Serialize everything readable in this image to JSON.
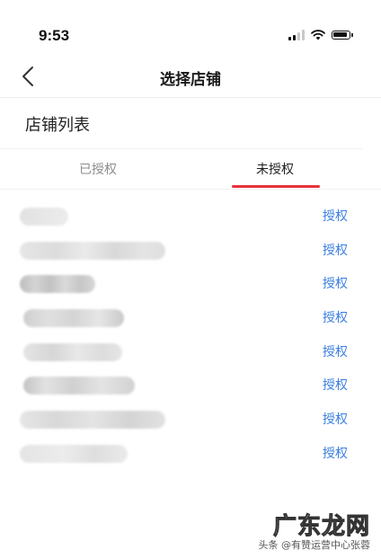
{
  "status_bar": {
    "time": "9:53",
    "icons": [
      "signal-icon",
      "wifi-icon",
      "battery-icon"
    ]
  },
  "nav": {
    "back_icon": "chevron-left-icon",
    "title": "选择店铺"
  },
  "section": {
    "title": "店铺列表"
  },
  "tabs": [
    {
      "label": "已授权",
      "active": false
    },
    {
      "label": "未授权",
      "active": true
    }
  ],
  "colors": {
    "accent_red": "#e8323c",
    "link_blue": "#3b7fe0",
    "inactive_tab": "#8c8c8c"
  },
  "stores": [
    {
      "name": "",
      "action": "授权"
    },
    {
      "name": "",
      "action": "授权"
    },
    {
      "name": "",
      "action": "授权"
    },
    {
      "name": "",
      "action": "授权"
    },
    {
      "name": "",
      "action": "授权"
    },
    {
      "name": "",
      "action": "授权"
    },
    {
      "name": "",
      "action": "授权"
    },
    {
      "name": "",
      "action": "授权"
    }
  ],
  "watermark": {
    "brand": "广东龙网",
    "caption": "头条 @有赞运营中心张蓉"
  }
}
